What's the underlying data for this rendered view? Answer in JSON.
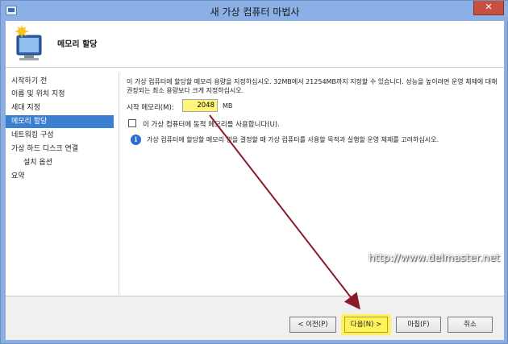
{
  "window": {
    "title": "새 가상 컴퓨터 마법사",
    "close_label": "✕"
  },
  "header": {
    "title": "메모리 할당",
    "icon": "wizard-computer-icon"
  },
  "nav": {
    "items": [
      {
        "label": "시작하기 전",
        "active": false,
        "sub": false
      },
      {
        "label": "이름 및 위치 지정",
        "active": false,
        "sub": false
      },
      {
        "label": "세대 지정",
        "active": false,
        "sub": false
      },
      {
        "label": "메모리 할당",
        "active": true,
        "sub": false
      },
      {
        "label": "네트워킹 구성",
        "active": false,
        "sub": false
      },
      {
        "label": "가상 하드 디스크 연결",
        "active": false,
        "sub": false
      },
      {
        "label": "설치 옵션",
        "active": false,
        "sub": true
      },
      {
        "label": "요약",
        "active": false,
        "sub": false
      }
    ]
  },
  "content": {
    "description": "이 가상 컴퓨터에 할당할 메모리 용량을 지정하십시오. 32MB에서 21254MB까지 지정할 수 있습니다. 성능을 높이려면 운영 체제에 대해 권장되는 최소 용량보다 크게 지정하십시오.",
    "startup_memory_label": "시작 메모리(M):",
    "startup_memory_value": "2048",
    "memory_unit": "MB",
    "dynamic_memory_label": "이 가상 컴퓨터에 동적 메모리를 사용합니다(U).",
    "dynamic_memory_checked": false,
    "info_text": "가상 컴퓨터에 할당할 메모리 양을 결정할 때 가상 컴퓨터를 사용할 목적과 실행할 운영 체제를 고려하십시오."
  },
  "watermark": "http://www.delmaster.net",
  "footer": {
    "back_label": "< 이전(P)",
    "next_label": "다음(N) >",
    "finish_label": "마침(F)",
    "cancel_label": "취소"
  },
  "colors": {
    "active_nav": "#3a7fd0",
    "highlight": "#fff25a",
    "arrow": "#8b1a2a"
  }
}
